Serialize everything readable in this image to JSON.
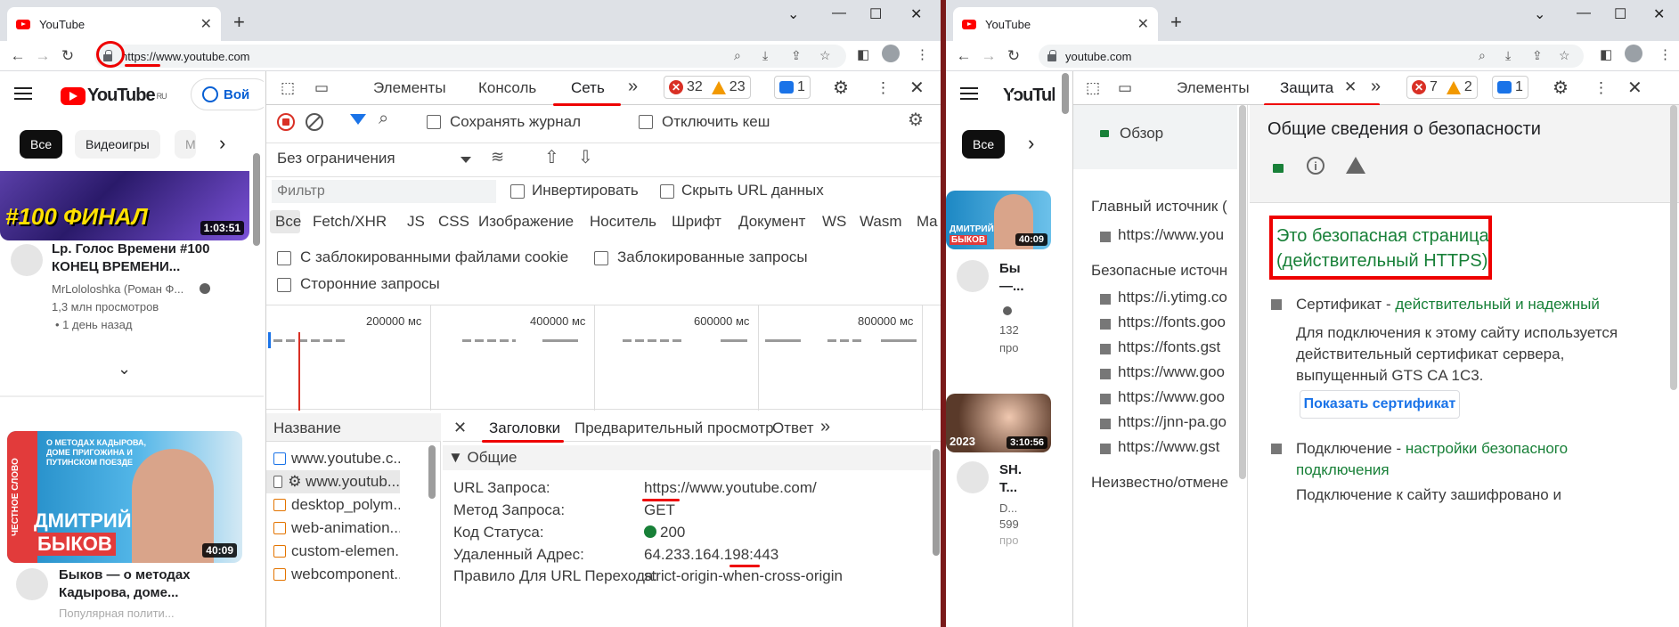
{
  "left": {
    "tab_title": "YouTube",
    "url": "https://www.youtube.com",
    "yt": {
      "logo": "YouTube",
      "region": "RU",
      "signin": "Вой",
      "chips": [
        "Все",
        "Видеоигры",
        "М"
      ],
      "video1": {
        "title_line1": "Lp. Голос Времени #100",
        "title_line2": "КОНЕЦ ВРЕМЕНИ...",
        "channel": "MrLololoshka (Роман Ф...",
        "views": "1,3 млн просмотров",
        "age": "• 1 день назад",
        "duration": "1:03:51",
        "thumb_text": "#100 ФИНАЛ"
      },
      "video2": {
        "title_line1": "Быков — о методах",
        "title_line2": "Кадырова, доме...",
        "meta": "Популярная полити...",
        "duration": "40:09",
        "thumb_name1": "ДМИТРИЙ",
        "thumb_name2": "БЫКОВ",
        "thumb_side": "ЧЕСТНОЕ СЛОВО",
        "thumb_caption": "О МЕТОДАХ КАДЫРОВА, ДОМЕ ПРИГОЖИНА И ПУТИНСКОМ ПОЕЗДЕ"
      }
    },
    "devtools": {
      "tabs": [
        "Элементы",
        "Консоль",
        "Сеть"
      ],
      "active_tab": "Сеть",
      "errors": "32",
      "warnings": "23",
      "messages": "1",
      "preserve_log": "Сохранять журнал",
      "disable_cache": "Отключить кеш",
      "throttle": "Без ограничения",
      "filter_placeholder": "Фильтр",
      "invert": "Инвертировать",
      "hide_data": "Скрыть URL данных",
      "types": [
        "Все",
        "Fetch/XHR",
        "JS",
        "CSS",
        "Изображение",
        "Носитель",
        "Шрифт",
        "Документ",
        "WS",
        "Wasm",
        "Ma"
      ],
      "blocked_cookies": "С заблокированными файлами cookie",
      "blocked_requests": "Заблокированные запросы",
      "third_party": "Сторонние запросы",
      "timeline_ticks": [
        "200000 мс",
        "400000 мс",
        "600000 мс",
        "800000 мс"
      ],
      "name_header": "Название",
      "requests": [
        "www.youtube.c...",
        "⚙ www.youtub...",
        "desktop_polym...",
        "web-animation...",
        "custom-elemen...",
        "webcomponent..."
      ],
      "detail_tabs": [
        "Заголовки",
        "Предварительный просмотр",
        "Ответ"
      ],
      "general_label": "▼ Общие",
      "general": [
        {
          "k": "URL Запроса:",
          "v": "https://www.youtube.com/"
        },
        {
          "k": "Метод Запроса:",
          "v": "GET"
        },
        {
          "k": "Код Статуса:",
          "v": "200"
        },
        {
          "k": "Удаленный Адрес:",
          "v": "64.233.164.198:443"
        },
        {
          "k": "Правило Для URL Перехода:",
          "v": "strict-origin-when-cross-origin"
        }
      ]
    }
  },
  "right": {
    "tab_title": "YouTube",
    "url": "youtube.com",
    "yt": {
      "chip": "Все",
      "v1": {
        "title": "Бы",
        "title2": "—...",
        "meta1": "132",
        "meta2": "про",
        "duration": "40:09",
        "thumb_name1": "ДМИТРИЙ",
        "thumb_name2": "БЫКОВ"
      },
      "v2": {
        "title": "SH.",
        "title2": "T...",
        "meta1": "D...",
        "meta2": "599",
        "meta3": "про",
        "duration": "3:10:56",
        "year": "2023"
      }
    },
    "devtools": {
      "tabs": [
        "Элементы",
        "Защита"
      ],
      "active_tab": "Защита",
      "errors": "7",
      "warnings": "2",
      "messages": "1",
      "overview": "Обзор",
      "main_origin": "Главный источник (",
      "main_origin_url": "https://www.you",
      "secure_origins": "Безопасные источн",
      "secure_urls": [
        "https://i.ytimg.co",
        "https://fonts.goo",
        "https://fonts.gst",
        "https://www.goo",
        "https://www.goo",
        "https://jnn-pa.go",
        "https://www.gst"
      ],
      "unknown": "Неизвестно/отмене",
      "title": "Общие сведения о безопасности",
      "secure_line1": "Это безопасная страница",
      "secure_line2": "(действительный HTTPS).",
      "cert_label": "Сертификат - ",
      "cert_status": "действительный и надежный",
      "cert_desc": [
        "Для подключения к этому сайту используется",
        "действительный сертификат сервера,",
        "выпущенный GTS CA 1C3."
      ],
      "show_cert": "Показать сертификат",
      "conn_label": "Подключение - ",
      "conn_status1": "настройки безопасного",
      "conn_status2": "подключения",
      "conn_desc": "Подключение к сайту зашифровано и"
    }
  },
  "colors": {
    "accent_red": "#ee0000",
    "secure_green": "#188038",
    "link_blue": "#1a73e8"
  }
}
